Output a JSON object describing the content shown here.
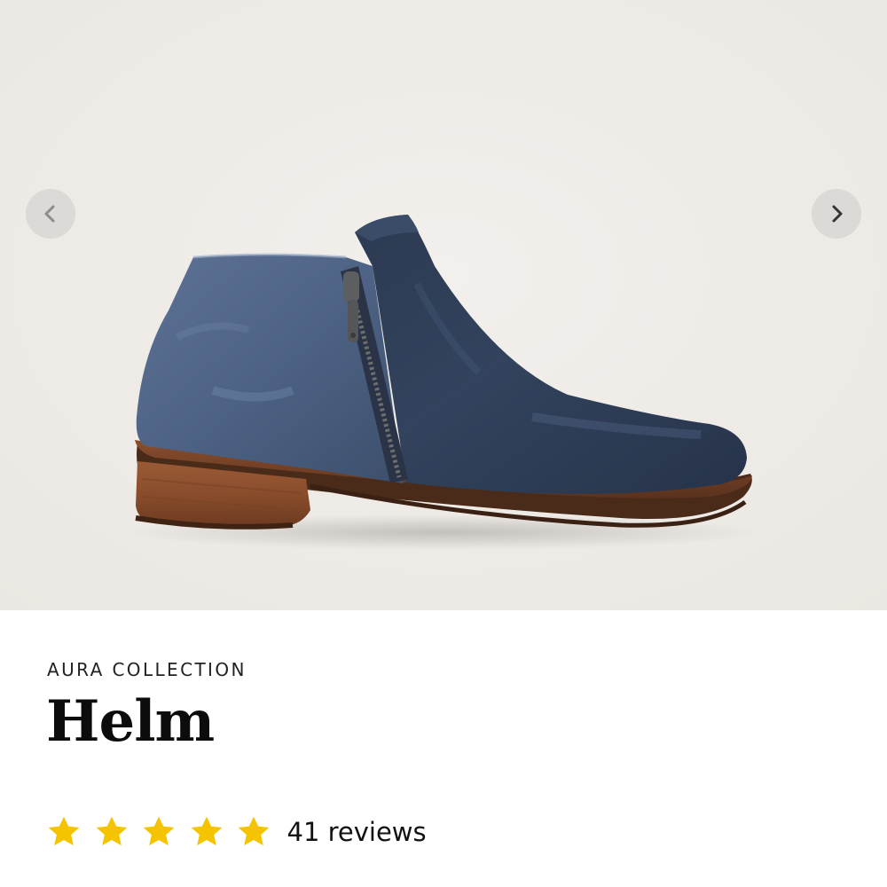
{
  "gallery": {
    "background_color": "#efece8",
    "product_image_icon": "ankle-boot-image",
    "prev_icon": "chevron-left-icon",
    "next_icon": "chevron-right-icon"
  },
  "product": {
    "collection": "AURA COLLECTION",
    "name": "Helm",
    "rating": {
      "stars": 5,
      "max_stars": 5,
      "star_color": "#f5c400",
      "star_icon": "star-icon",
      "reviews_label": "41 reviews"
    }
  }
}
